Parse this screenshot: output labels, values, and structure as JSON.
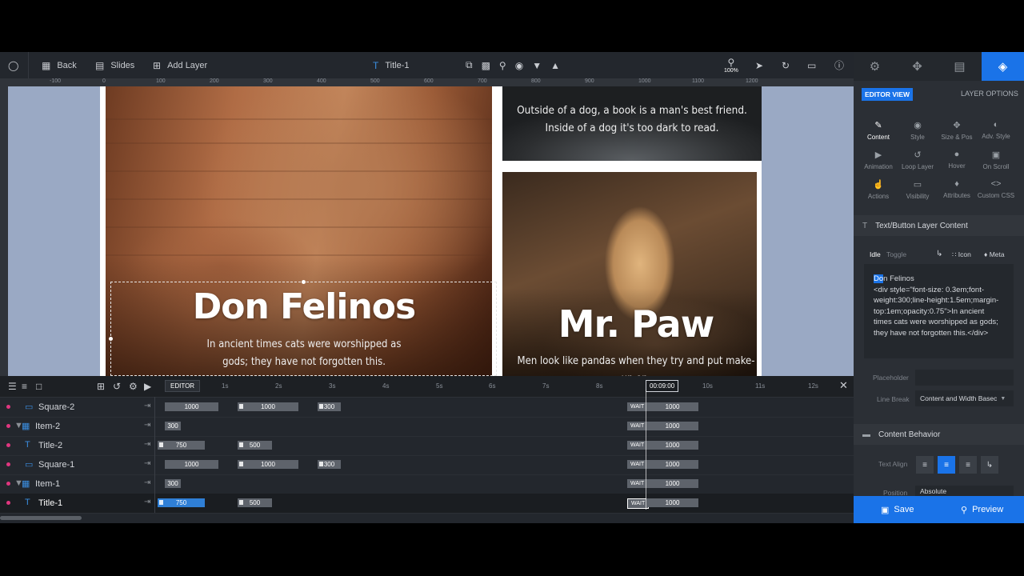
{
  "toolbar": {
    "back": "Back",
    "slides": "Slides",
    "add_layer": "Add Layer",
    "current_layer": "Title-1",
    "zoom": "100%"
  },
  "ruler": {
    "h_labels": [
      "-100",
      "0",
      "100",
      "200",
      "300",
      "400",
      "500",
      "600",
      "700",
      "800",
      "900",
      "1000",
      "1100",
      "1200"
    ]
  },
  "slide": {
    "top_right_sub": "Outside of a dog, a book is a man's best friend. Inside of a dog it's too dark to read.",
    "title_1": "Don Felinos",
    "sub_1": "In ancient times cats were worshipped as gods; they have not forgotten this.",
    "title_2": "Mr. Paw",
    "sub_2": "Men look like pandas when they try and put make-up on."
  },
  "timeline": {
    "editor_label": "EDITOR",
    "ticks": [
      "1s",
      "2s",
      "3s",
      "4s",
      "5s",
      "6s",
      "7s",
      "8s",
      "9s",
      "10s",
      "11s",
      "12s"
    ],
    "playhead_time": "00:09:00",
    "wait_label": "WAIT",
    "rows": [
      {
        "name": "Square-2",
        "bars": [
          "1000",
          "1000",
          "300"
        ],
        "end": "1000"
      },
      {
        "name": "Item-2",
        "bars": [
          "300"
        ],
        "end": "1000"
      },
      {
        "name": "Title-2",
        "bars": [
          "750",
          "500"
        ],
        "end": "1000"
      },
      {
        "name": "Square-1",
        "bars": [
          "1000",
          "1000",
          "300"
        ],
        "end": "1000"
      },
      {
        "name": "Item-1",
        "bars": [
          "300"
        ],
        "end": "1000"
      },
      {
        "name": "Title-1",
        "bars": [
          "750",
          "500"
        ],
        "end": "1000"
      }
    ]
  },
  "panel": {
    "editor_view": "EDITOR VIEW",
    "layer_options": "LAYER OPTIONS",
    "props": [
      "Content",
      "Style",
      "Size & Pos",
      "Adv. Style",
      "Animation",
      "Loop Layer",
      "Hover",
      "On Scroll",
      "Actions",
      "Visibility",
      "Attributes",
      "Custom CSS"
    ],
    "section_content": "Text/Button Layer Content",
    "idle": "Idle",
    "toggle": "Toggle",
    "icon": "Icon",
    "meta": "Meta",
    "code_highlight": "Do",
    "code_rest_first": "n Felinos",
    "code_body": "<div style=\"font-size: 0.3em;font-weight:300;line-height:1.5em;margin-top:1em;opacity:0.75\">In ancient times cats were worshipped as gods; they have not forgotten this.</div>",
    "placeholder_label": "Placeholder",
    "line_break_label": "Line Break",
    "line_break_value": "Content and Width Basec",
    "section_behavior": "Content Behavior",
    "text_align_label": "Text Align",
    "position_label": "Position",
    "position_value": "Absolute",
    "save": "Save",
    "preview": "Preview"
  }
}
